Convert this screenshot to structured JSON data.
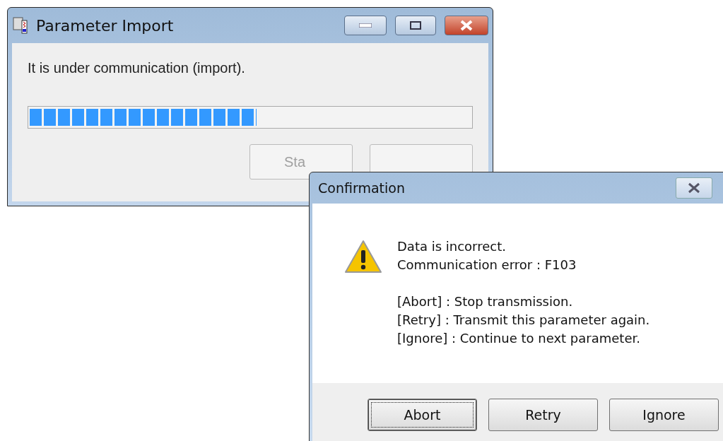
{
  "main_window": {
    "title": "Parameter Import",
    "message": "It is under communication (import).",
    "progress": {
      "level": 0.515
    },
    "buttons": [
      {
        "label": "Sta",
        "disabled": true
      },
      {
        "disabled": true
      }
    ]
  },
  "dialog": {
    "title": "Confirmation",
    "error_lines": [
      "Data is incorrect.",
      "Communication error : F103"
    ],
    "help_lines": [
      "[Abort] : Stop transmission.",
      "[Retry] : Transmit this parameter again.",
      "[Ignore] : Continue to next parameter."
    ],
    "buttons": [
      {
        "label": "Abort",
        "focused": true
      },
      {
        "label": "Retry",
        "focused": false
      },
      {
        "label": "Ignore",
        "focused": false
      }
    ]
  }
}
